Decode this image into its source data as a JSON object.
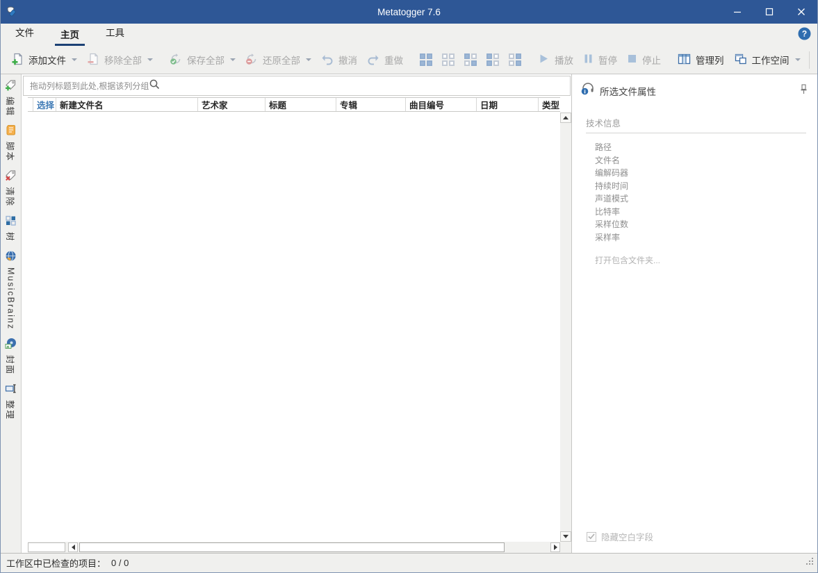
{
  "titlebar": {
    "app_icon": "metatogger-logo-icon",
    "title": "Metatogger 7.6",
    "controls": [
      "minimize",
      "maximize",
      "close"
    ]
  },
  "menu": {
    "tabs": [
      {
        "label": "文件",
        "active": false
      },
      {
        "label": "主页",
        "active": true
      },
      {
        "label": "工具",
        "active": false
      }
    ],
    "help_icon": "help-circle-icon"
  },
  "toolbar": {
    "add_files": {
      "label": "添加文件",
      "enabled": true,
      "dropdown": true,
      "icon": "file-plus-icon"
    },
    "remove_all": {
      "label": "移除全部",
      "enabled": false,
      "dropdown": true,
      "icon": "file-minus-icon"
    },
    "save_all": {
      "label": "保存全部",
      "enabled": false,
      "dropdown": true,
      "icon": "sync-check-icon"
    },
    "restore_all": {
      "label": "还原全部",
      "enabled": false,
      "dropdown": true,
      "icon": "sync-minus-icon"
    },
    "undo": {
      "label": "撤消",
      "enabled": false,
      "icon": "undo-arrow-icon"
    },
    "redo": {
      "label": "重做",
      "enabled": false,
      "icon": "redo-arrow-icon"
    },
    "selection_buttons": [
      {
        "name": "check-all",
        "pattern": [
          1,
          1,
          1,
          1
        ]
      },
      {
        "name": "uncheck-all",
        "pattern": [
          0,
          0,
          0,
          0
        ]
      },
      {
        "name": "invert-check",
        "pattern": [
          1,
          0,
          0,
          1
        ]
      },
      {
        "name": "check-selected",
        "pattern": [
          1,
          0,
          1,
          0
        ]
      },
      {
        "name": "uncheck-selected",
        "pattern": [
          0,
          1,
          0,
          1
        ]
      }
    ],
    "play": {
      "label": "播放",
      "enabled": false,
      "icon": "play-icon"
    },
    "pause": {
      "label": "暂停",
      "enabled": false,
      "icon": "pause-icon"
    },
    "stop": {
      "label": "停止",
      "enabled": false,
      "icon": "stop-icon"
    },
    "manage_columns": {
      "label": "管理列",
      "enabled": true,
      "icon": "table-columns-icon"
    },
    "workspace": {
      "label": "工作空间",
      "enabled": true,
      "dropdown": true,
      "icon": "workspace-windows-icon"
    },
    "collapse_icon": "chevron-down-icon"
  },
  "sidebar": {
    "items": [
      {
        "label": "编辑",
        "icon": "tag-plus-icon"
      },
      {
        "label": "脚本",
        "icon": "script-icon"
      },
      {
        "label": "清除",
        "icon": "tag-remove-icon"
      },
      {
        "label": "树",
        "icon": "tree-chart-icon"
      },
      {
        "label": "MusicBrainz",
        "icon": "musicbrainz-globe-icon"
      },
      {
        "label": "封面",
        "icon": "cover-art-icon"
      },
      {
        "label": "整理",
        "icon": "rename-icon"
      }
    ]
  },
  "main": {
    "group_bar": {
      "hint": "拖动列标题到此处,根据该列分组",
      "search_icon": "magnifier-icon"
    },
    "table": {
      "columns": [
        "选择",
        "新建文件名",
        "艺术家",
        "标题",
        "专辑",
        "曲目编号",
        "日期",
        "类型"
      ],
      "rows": []
    }
  },
  "properties_panel": {
    "icon": "headphones-info-icon",
    "title": "所选文件属性",
    "pin_icon": "pushpin-icon",
    "section": "技术信息",
    "fields": [
      "路径",
      "文件名",
      "编解码器",
      "持续时间",
      "声道模式",
      "比特率",
      "采样位数",
      "采样率"
    ],
    "open_folder_link": "打开包含文件夹...",
    "hide_empty_checkbox": {
      "label": "隐藏空白字段",
      "checked": true,
      "enabled": false
    }
  },
  "statusbar": {
    "label": "工作区中已检查的项目：",
    "value": "0 / 0"
  },
  "colors": {
    "titlebar_bg": "#2e5796",
    "accent_blue": "#3a6ba5",
    "pale_blue": "#a3bbd8",
    "chrome_bg": "#f0f0ee",
    "tab_underline": "#1c4175",
    "header_link_blue": "#3f7ab5",
    "green_badge": "#3fae49",
    "red_badge": "#d64545"
  }
}
